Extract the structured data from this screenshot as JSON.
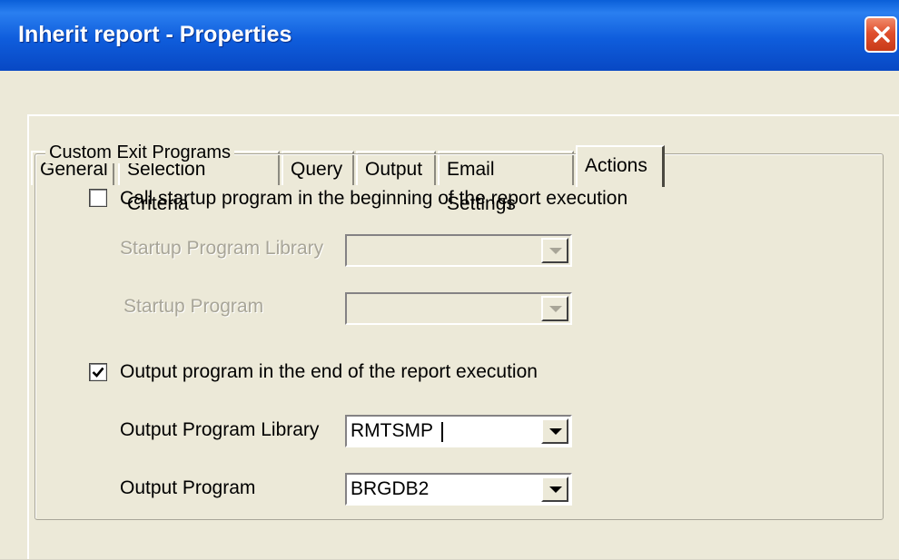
{
  "window": {
    "title": "Inherit report - Properties",
    "close_icon": "close-icon"
  },
  "tabs": [
    {
      "label": "General",
      "active": false
    },
    {
      "label": "Selection Criteria",
      "active": false
    },
    {
      "label": "Query",
      "active": false
    },
    {
      "label": "Output",
      "active": false
    },
    {
      "label": "Email Settings",
      "active": false
    },
    {
      "label": "Actions",
      "active": true
    }
  ],
  "group": {
    "label": "Custom Exit Programs"
  },
  "startup": {
    "checkbox_label": "Call startup program in the beginning of the report execution",
    "checked": false,
    "library_label": "Startup Program Library",
    "library_value": "",
    "program_label": "Startup Program",
    "program_value": "",
    "enabled": false
  },
  "output": {
    "checkbox_label": "Output program in the end of the report execution",
    "checked": true,
    "library_label": "Output Program Library",
    "library_value": "RMTSMP",
    "program_label": "Output Program",
    "program_value": "BRGDB2",
    "enabled": true
  },
  "colors": {
    "titlebar": "#0a5fd8",
    "dialog_bg": "#ece9d8",
    "close_button": "#e0502e",
    "disabled_text": "#a8a598"
  }
}
